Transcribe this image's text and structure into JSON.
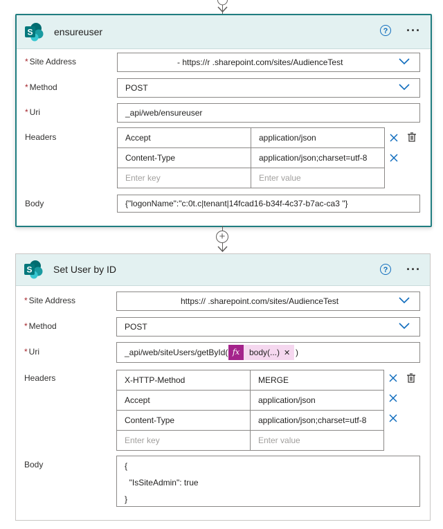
{
  "card1": {
    "title": "ensureuser",
    "site_address": {
      "label": "Site Address",
      "value": "- https://r            .sharepoint.com/sites/AudienceTest"
    },
    "method": {
      "label": "Method",
      "value": "POST"
    },
    "uri": {
      "label": "Uri",
      "value": "_api/web/ensureuser"
    },
    "headers": {
      "label": "Headers",
      "rows": [
        {
          "key": "Accept",
          "value": "application/json"
        },
        {
          "key": "Content-Type",
          "value": "application/json;charset=utf-8"
        }
      ],
      "key_placeholder": "Enter key",
      "value_placeholder": "Enter value"
    },
    "body": {
      "label": "Body",
      "value": "{\"logonName\":\"c:0t.c|tenant|14fcad16-b34f-4c37-b7ac-ca3                  \"}"
    }
  },
  "card2": {
    "title": "Set User by ID",
    "site_address": {
      "label": "Site Address",
      "value": "https://            .sharepoint.com/sites/AudienceTest"
    },
    "method": {
      "label": "Method",
      "value": "POST"
    },
    "uri": {
      "label": "Uri",
      "prefix": "_api/web/siteUsers/getById(",
      "token": "body(...)",
      "suffix": ")",
      "token_icon": "fx"
    },
    "headers": {
      "label": "Headers",
      "rows": [
        {
          "key": "X-HTTP-Method",
          "value": "MERGE"
        },
        {
          "key": "Accept",
          "value": "application/json"
        },
        {
          "key": "Content-Type",
          "value": "application/json;charset=utf-8"
        }
      ],
      "key_placeholder": "Enter key",
      "value_placeholder": "Enter value"
    },
    "body": {
      "label": "Body",
      "lines": [
        "{",
        "  \"IsSiteAdmin\": true",
        "}"
      ]
    }
  },
  "required_marker": "*",
  "colors": {
    "header_bg": "#e3f1f1",
    "accent": "#1f7d80",
    "link_blue": "#0f6cbd",
    "token_purple": "#a4238b",
    "token_bg": "#f5d7ef"
  }
}
